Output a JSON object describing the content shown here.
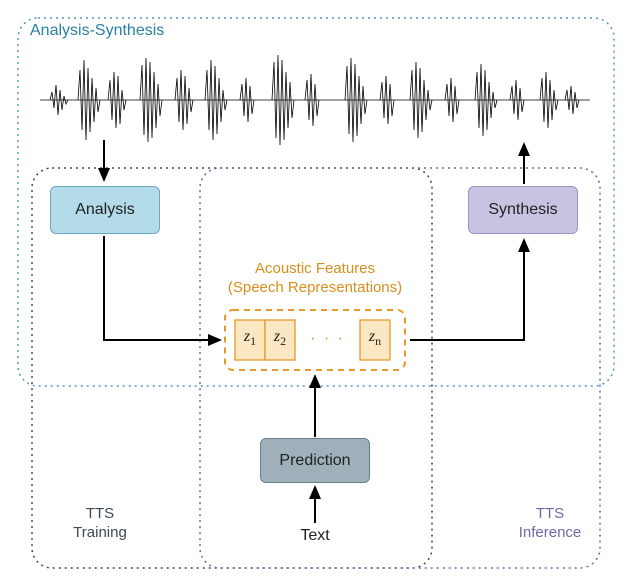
{
  "diagram": {
    "as_title": "Analysis-Synthesis",
    "analysis_label": "Analysis",
    "synthesis_label": "Synthesis",
    "prediction_label": "Prediction",
    "text_input_label": "Text",
    "acoustic_label_line1": "Acoustic Features",
    "acoustic_label_line2": "(Speech Representations)",
    "features": {
      "z1": "z",
      "z1_sub": "1",
      "z2": "z",
      "z2_sub": "2",
      "dots": "· · ·",
      "zn": "z",
      "zn_sub": "n"
    },
    "tts_training_line1": "TTS",
    "tts_training_line2": "Training",
    "tts_inference_line1": "TTS",
    "tts_inference_line2": "Inference"
  },
  "colors": {
    "as_frame": "#4a9cc0",
    "tts_train_frame": "#3b4a5a",
    "tts_infer_frame": "#6a6aa8",
    "acoustic_frame": "#e59a2c",
    "acoustic_fill": "#fbe7c1",
    "analysis_fill": "#b4dbe9",
    "synthesis_fill": "#c7c4e2",
    "prediction_fill": "#9fb0bb"
  }
}
